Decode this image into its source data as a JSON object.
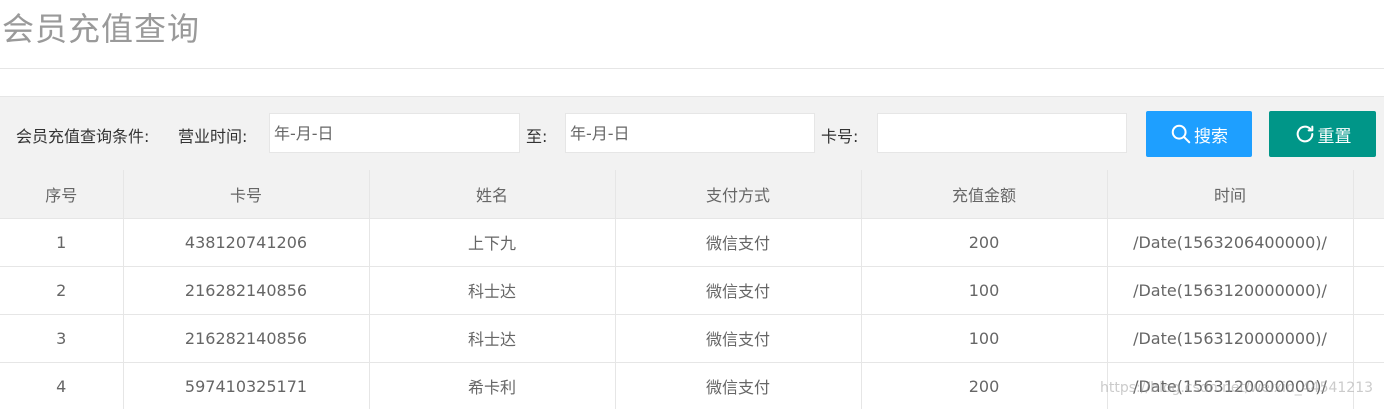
{
  "page": {
    "title": "会员充值查询"
  },
  "filter": {
    "prefix_label": "会员充值查询条件:",
    "business_time_label": "营业时间:",
    "start_date_placeholder": "年-月-日",
    "to_label": "至:",
    "end_date_placeholder": "年-月-日",
    "card_label": "卡号:",
    "card_value": "",
    "search_label": "搜索",
    "reset_label": "重置"
  },
  "table": {
    "headers": [
      "序号",
      "卡号",
      "姓名",
      "支付方式",
      "充值金额",
      "时间",
      ""
    ],
    "rows": [
      [
        "1",
        "438120741206",
        "上下九",
        "微信支付",
        "200",
        "/Date(1563206400000)/"
      ],
      [
        "2",
        "216282140856",
        "科士达",
        "微信支付",
        "100",
        "/Date(1563120000000)/"
      ],
      [
        "3",
        "216282140856",
        "科士达",
        "微信支付",
        "100",
        "/Date(1563120000000)/"
      ],
      [
        "4",
        "597410325171",
        "希卡利",
        "微信支付",
        "200",
        "/Date(1563120000000)/"
      ]
    ]
  },
  "watermark": "https://blog.csdn.net/weixin_44541213",
  "colors": {
    "search_button": "#1e9fff",
    "reset_button": "#009688",
    "header_bg": "#f2f2f2"
  },
  "icons": {
    "search": "search-icon",
    "reset": "refresh-icon"
  }
}
